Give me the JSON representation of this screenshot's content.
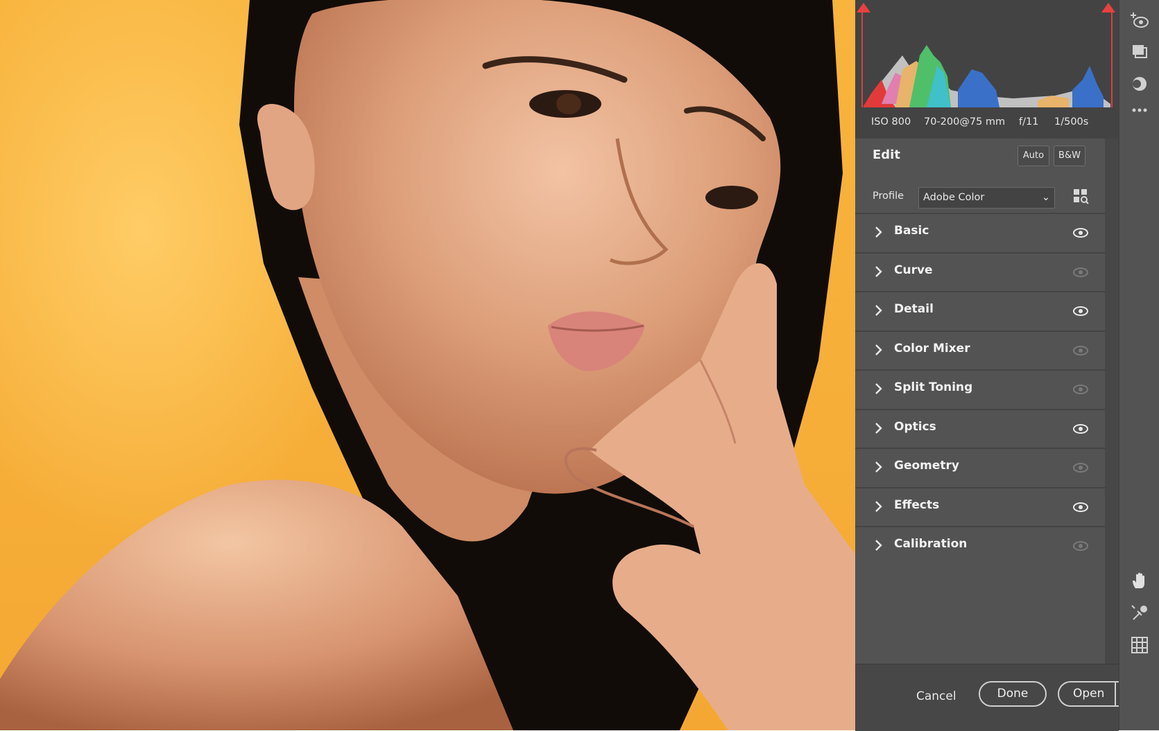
{
  "exif": {
    "iso": "ISO 800",
    "lens": "70-200@75 mm",
    "aperture": "f/11",
    "shutter": "1/500s"
  },
  "edit": {
    "title": "Edit",
    "auto_label": "Auto",
    "bw_label": "B&W"
  },
  "profile": {
    "label": "Profile",
    "value": "Adobe Color"
  },
  "sections": [
    {
      "label": "Basic",
      "visible": true
    },
    {
      "label": "Curve",
      "visible": false
    },
    {
      "label": "Detail",
      "visible": true
    },
    {
      "label": "Color Mixer",
      "visible": false
    },
    {
      "label": "Split Toning",
      "visible": false
    },
    {
      "label": "Optics",
      "visible": true
    },
    {
      "label": "Geometry",
      "visible": false
    },
    {
      "label": "Effects",
      "visible": true
    },
    {
      "label": "Calibration",
      "visible": false
    }
  ],
  "actions": {
    "cancel": "Cancel",
    "done": "Done",
    "open": "Open"
  },
  "tools": [
    "edit-eye-icon",
    "presets-icon",
    "masking-icon",
    "more-icon",
    "hand-icon",
    "eyedropper-icon",
    "grid-icon"
  ],
  "colors": {
    "panel_bg": "#535353",
    "photo_bg": "#f6ae38",
    "clip_warning": "#e94040"
  }
}
